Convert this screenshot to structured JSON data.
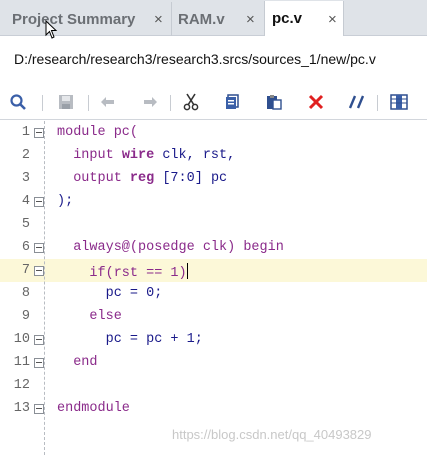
{
  "tabs": [
    {
      "label": "Project Summary",
      "close": "×"
    },
    {
      "label": "RAM.v",
      "close": "×"
    },
    {
      "label": "pc.v",
      "close": "×"
    }
  ],
  "file_path": "D:/research/research3/research3.srcs/sources_1/new/pc.v",
  "toolbar": {
    "icons": [
      "search-icon",
      "save-icon",
      "undo-icon",
      "redo-icon",
      "cut-icon",
      "copy-icon",
      "paste-icon",
      "delete-icon",
      "comment-icon",
      "columns-icon"
    ]
  },
  "code": {
    "lines": [
      {
        "n": "1",
        "fold": true,
        "parts": [
          {
            "t": "module pc(",
            "c": "kw"
          }
        ]
      },
      {
        "n": "2",
        "fold": false,
        "parts": [
          {
            "t": "  input ",
            "c": "kw"
          },
          {
            "t": "wire",
            "c": "kwb"
          },
          {
            "t": " clk, rst,",
            "c": ""
          }
        ]
      },
      {
        "n": "3",
        "fold": false,
        "parts": [
          {
            "t": "  output ",
            "c": "kw"
          },
          {
            "t": "reg",
            "c": "kwb"
          },
          {
            "t": " [7:0] pc",
            "c": ""
          }
        ]
      },
      {
        "n": "4",
        "fold": true,
        "parts": [
          {
            "t": ");",
            "c": ""
          }
        ]
      },
      {
        "n": "5",
        "fold": false,
        "parts": []
      },
      {
        "n": "6",
        "fold": true,
        "parts": [
          {
            "t": "  always@(posedge clk) begin",
            "c": "kw"
          }
        ]
      },
      {
        "n": "7",
        "fold": true,
        "parts": [
          {
            "t": "    if(rst == 1)",
            "c": "kw"
          }
        ],
        "highlight": true,
        "caret": true
      },
      {
        "n": "8",
        "fold": false,
        "parts": [
          {
            "t": "      pc = 0;",
            "c": ""
          }
        ]
      },
      {
        "n": "9",
        "fold": false,
        "parts": [
          {
            "t": "    else",
            "c": "kw"
          }
        ]
      },
      {
        "n": "10",
        "fold": true,
        "parts": [
          {
            "t": "      pc = pc + 1;",
            "c": ""
          }
        ]
      },
      {
        "n": "11",
        "fold": true,
        "parts": [
          {
            "t": "  end",
            "c": "kw"
          }
        ]
      },
      {
        "n": "12",
        "fold": false,
        "parts": []
      },
      {
        "n": "13",
        "fold": true,
        "parts": [
          {
            "t": "endmodule",
            "c": "kw"
          }
        ]
      }
    ]
  },
  "watermark": "https://blog.csdn.net/qq_40493829",
  "colors": {
    "keyword": "#8a2a8a",
    "delete": "#e02020",
    "icon": "#3a5fa8"
  }
}
